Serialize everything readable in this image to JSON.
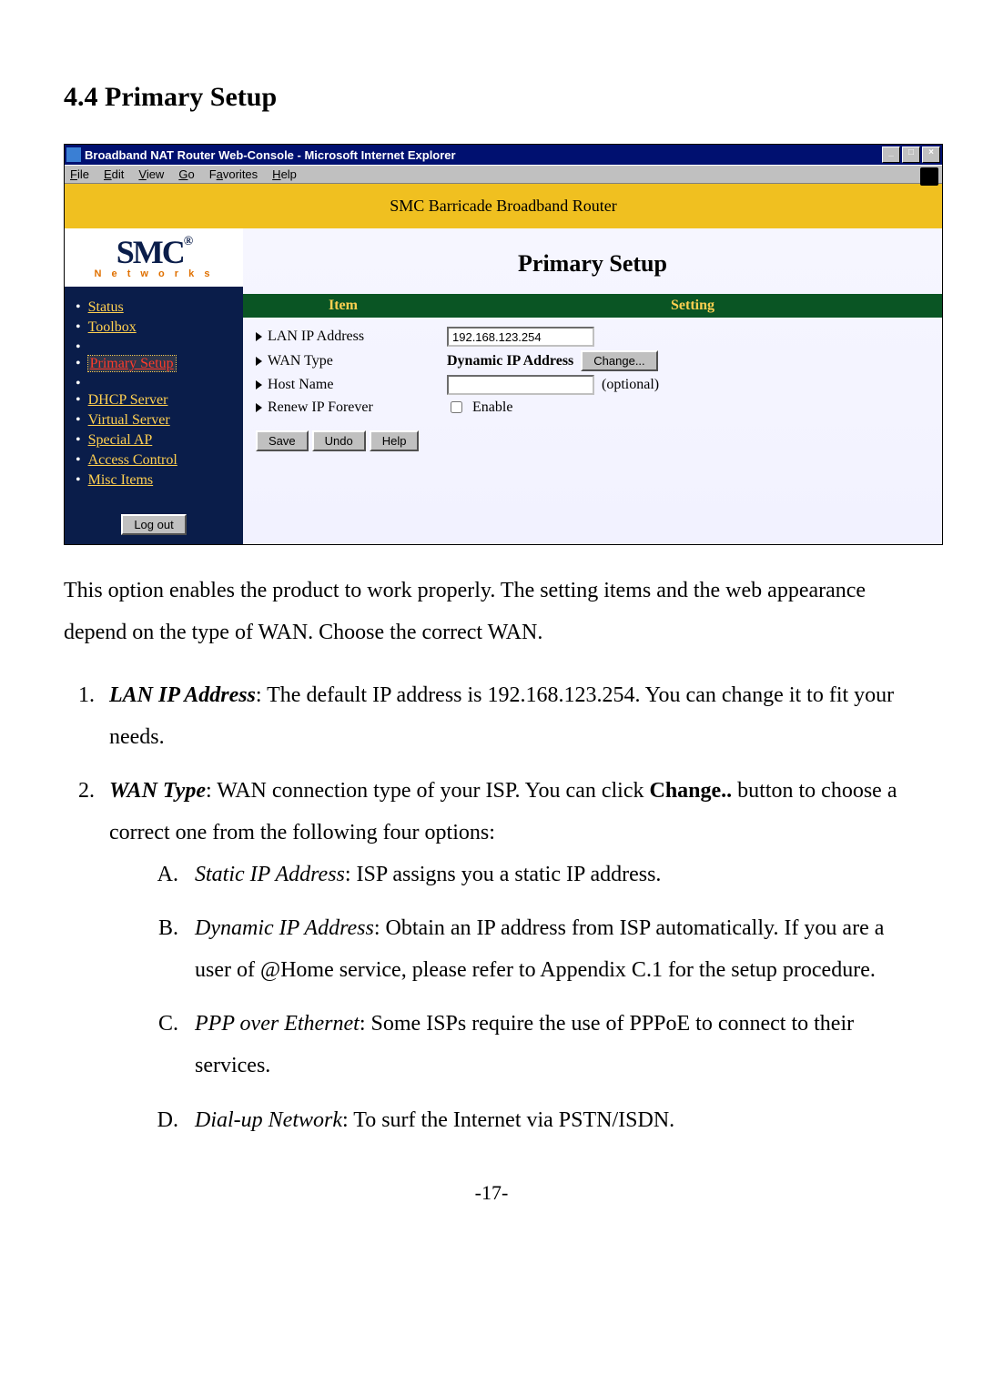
{
  "section_title": "4.4 Primary Setup",
  "window": {
    "title": "Broadband NAT Router Web-Console - Microsoft Internet Explorer",
    "min": "_",
    "max": "□",
    "close": "×"
  },
  "menu": {
    "file": "File",
    "edit": "Edit",
    "view": "View",
    "go": "Go",
    "favorites": "Favorites",
    "help": "Help"
  },
  "banner": "SMC Barricade Broadband Router",
  "logo": {
    "main": "SMC",
    "sub": "N e t w o r k s",
    "reg": "®"
  },
  "nav": {
    "status": "Status",
    "toolbox": "Toolbox",
    "primary": "Primary Setup",
    "dhcp": "DHCP Server",
    "virtual": "Virtual Server",
    "special": "Special AP",
    "access": "Access Control",
    "misc": "Misc Items",
    "logout": "Log out"
  },
  "pane": {
    "title": "Primary Setup",
    "head_item": "Item",
    "head_setting": "Setting",
    "rows": {
      "lan_label": "LAN IP Address",
      "lan_value": "192.168.123.254",
      "wan_label": "WAN Type",
      "wan_value": "Dynamic IP Address",
      "wan_change": "Change...",
      "host_label": "Host Name",
      "host_value": "",
      "host_optional": "(optional)",
      "renew_label": "Renew IP Forever",
      "renew_enable": "Enable"
    },
    "buttons": {
      "save": "Save",
      "undo": "Undo",
      "help": "Help"
    }
  },
  "body": {
    "intro": "This option enables the product to work properly. The setting items and the web appearance depend on the type of WAN. Choose the correct WAN.",
    "li1_label": "LAN IP Address",
    "li1_text": ": The default IP address is 192.168.123.254. You can change it to fit your needs.",
    "li2_label": "WAN Type",
    "li2_text_a": ": WAN connection type of your ISP. You can click ",
    "li2_change": "Change..",
    "li2_text_b": " button to choose a correct one from the following four options:",
    "sA_label": "Static IP Address",
    "sA_text": ": ISP assigns you a static IP address.",
    "sB_label": "Dynamic IP Address",
    "sB_text": ": Obtain an IP address from ISP automatically. If you are a user of @Home service, please refer to Appendix C.1 for the setup procedure.",
    "sC_label": "PPP over Ethernet",
    "sC_text": ": Some ISPs require the use of PPPoE to connect to their services.",
    "sD_label": "Dial-up Network",
    "sD_text": ": To surf the Internet via PSTN/ISDN."
  },
  "page_number": "-17-"
}
